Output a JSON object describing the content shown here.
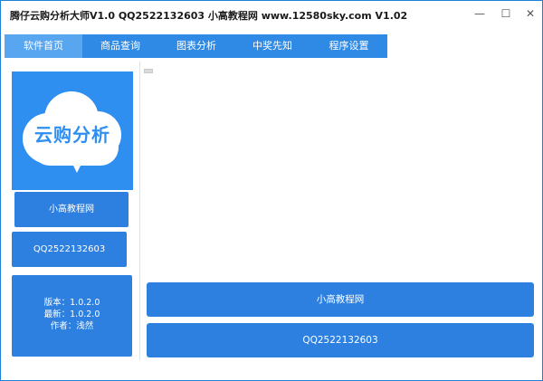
{
  "window": {
    "title": "腾仔云购分析大师V1.0 QQ2522132603 小高教程网 www.12580sky.com V1.02",
    "min_glyph": "—",
    "max_glyph": "☐",
    "close_glyph": "✕"
  },
  "tabs": [
    {
      "label": "软件首页",
      "active": true
    },
    {
      "label": "商品查询",
      "active": false
    },
    {
      "label": "图表分析",
      "active": false
    },
    {
      "label": "中奖先知",
      "active": false
    },
    {
      "label": "程序设置",
      "active": false
    }
  ],
  "logo": {
    "text": "云购分析"
  },
  "sidebar": {
    "button1": "小高教程网",
    "button2": "QQ2522132603",
    "version_line1": "版本：1.0.2.0",
    "version_line2": "最新：1.0.2.0",
    "version_line3": "作者：浅然"
  },
  "main": {
    "button1": "小高教程网",
    "button2": "QQ2522132603"
  },
  "colors": {
    "accent": "#2e80e0",
    "tab_bar": "#2f8ae6",
    "tab_active": "#59a6f0",
    "logo_bg": "#2e8ff0"
  }
}
